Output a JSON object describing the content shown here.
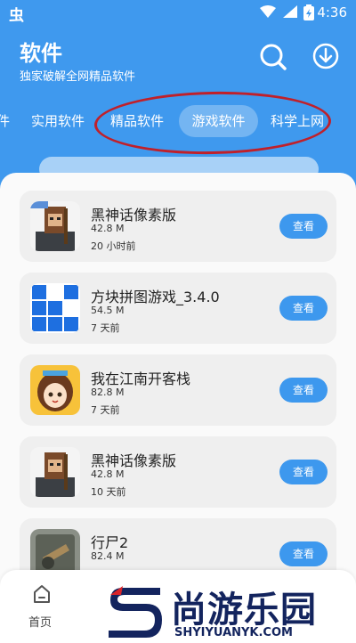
{
  "status_bar": {
    "time": "4:36",
    "app_icon_glyph": "虫"
  },
  "header": {
    "title": "软件",
    "subtitle": "独家破解全网精品软件"
  },
  "tabs": [
    {
      "label": "件"
    },
    {
      "label": "实用软件"
    },
    {
      "label": "精品软件"
    },
    {
      "label": "游戏软件",
      "active": true
    },
    {
      "label": "科学上网"
    }
  ],
  "apps": [
    {
      "name": "黑神话像素版",
      "size": "42.8 M",
      "time": "20 小时前",
      "button": "查看",
      "icon": "pixel-warrior-icon"
    },
    {
      "name": "方块拼图游戏_3.4.0",
      "size": "54.5 M",
      "time": "7 天前",
      "button": "查看",
      "icon": "block-puzzle-icon"
    },
    {
      "name": "我在江南开客栈",
      "size": "82.8 M",
      "time": "7 天前",
      "button": "查看",
      "icon": "anime-girl-icon"
    },
    {
      "name": "黑神话像素版",
      "size": "42.8 M",
      "time": "10 天前",
      "button": "查看",
      "icon": "pixel-warrior-icon"
    },
    {
      "name": "行尸2",
      "size": "82.4 M",
      "time": "",
      "button": "查看",
      "icon": "zombie-game-icon"
    }
  ],
  "bottom_nav": {
    "home_label": "首页"
  },
  "watermark": {
    "text": "尚游乐园",
    "url": "SHYIYUANYK.COM"
  },
  "colors": {
    "accent": "#3d98ee",
    "highlight_oval": "#c0202a",
    "card_bg": "#efefef",
    "watermark": "#13245e"
  }
}
